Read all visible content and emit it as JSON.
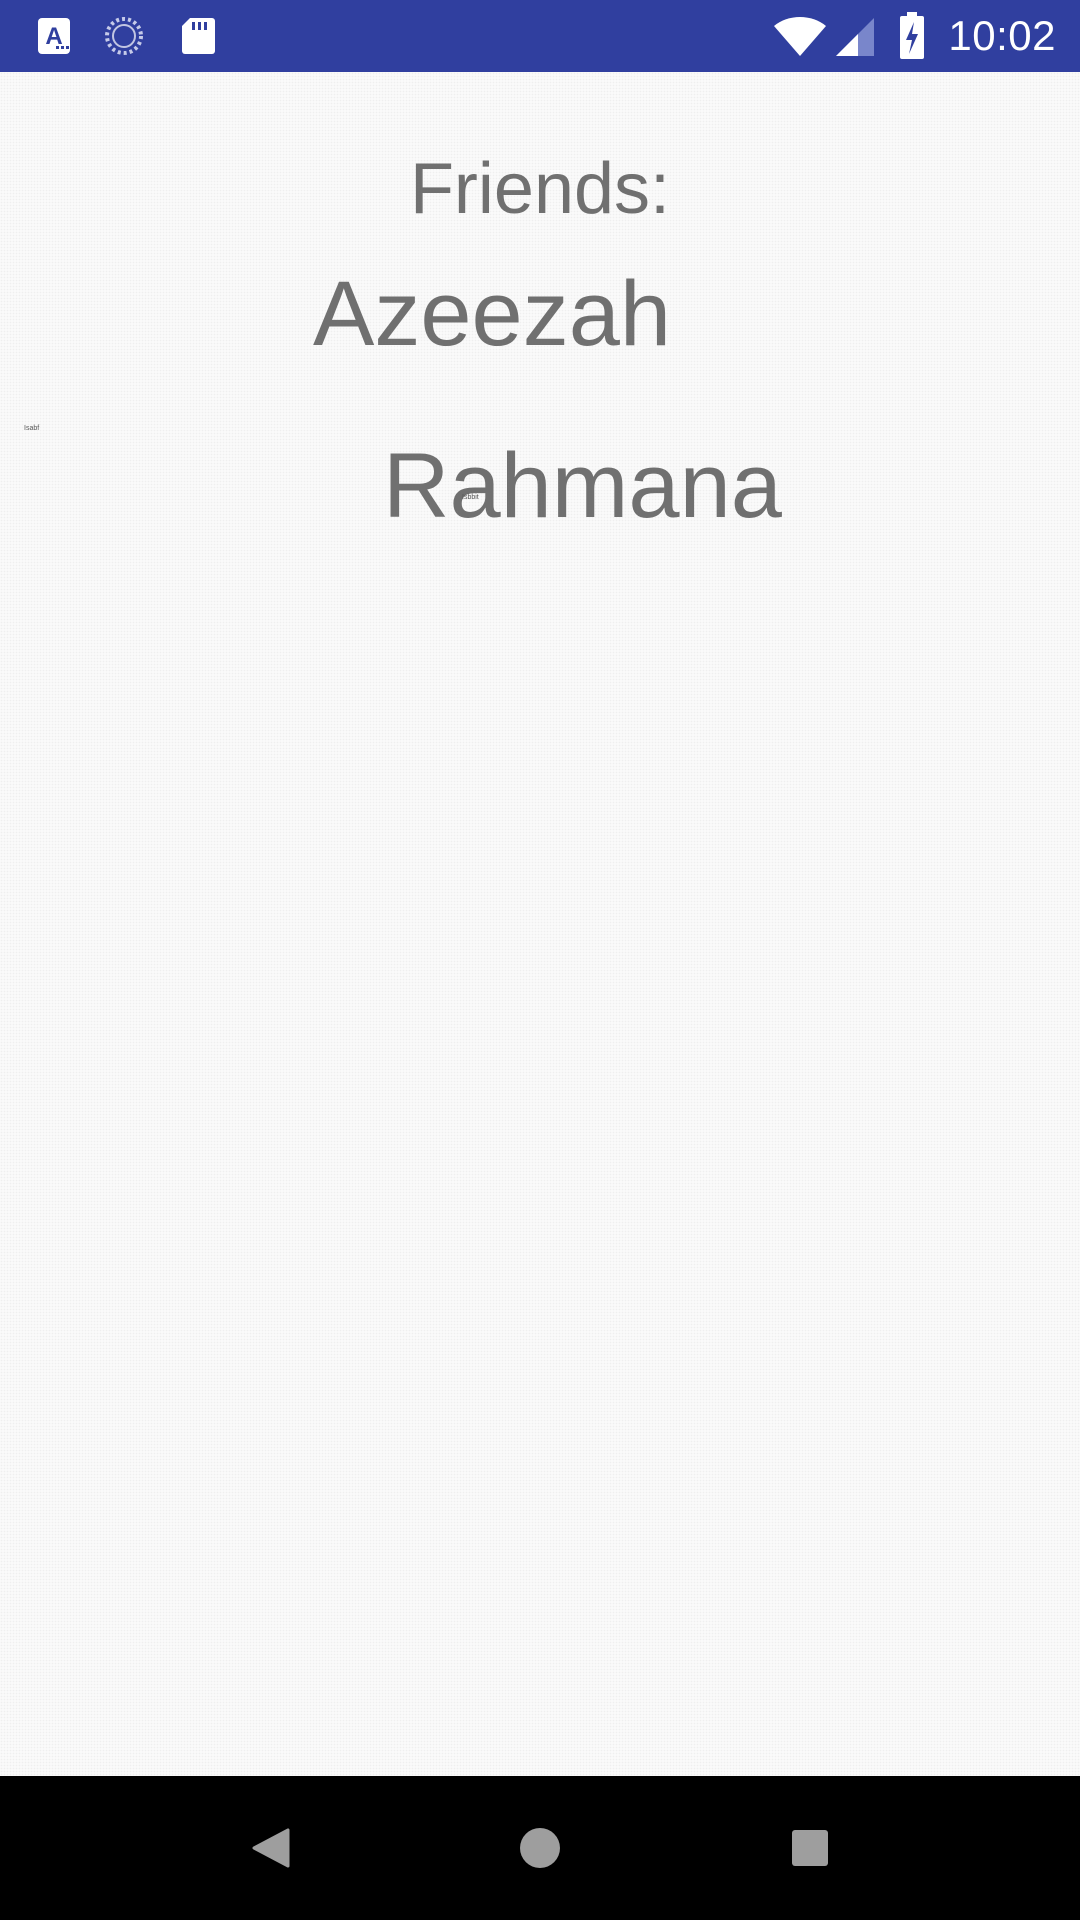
{
  "status_bar": {
    "time": "10:02",
    "left_icons": [
      "font-app-icon",
      "loading-spinner-icon",
      "sd-card-icon"
    ],
    "right_icons": [
      "wifi-icon",
      "cell-signal-icon",
      "battery-charging-icon"
    ],
    "background_color": "#303f9f"
  },
  "main": {
    "title": "Friends:",
    "friends": [
      "Azeezah",
      "Rahmana"
    ],
    "tiny_labels": [
      "Isabf",
      "Isbbit"
    ]
  },
  "nav_bar": {
    "buttons": [
      "back-icon",
      "home-icon",
      "recents-icon"
    ]
  },
  "colors": {
    "text": "#707070",
    "nav_background": "#000000",
    "nav_icon": "#9e9e9e"
  }
}
